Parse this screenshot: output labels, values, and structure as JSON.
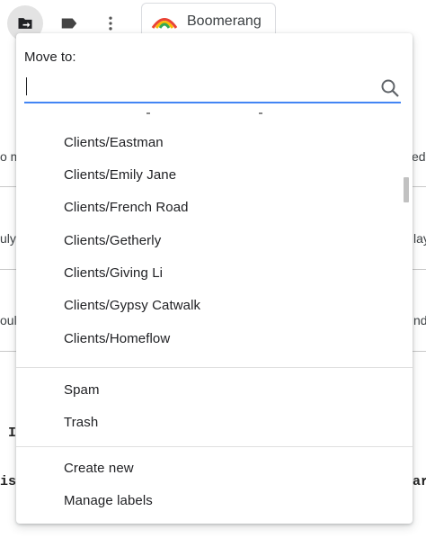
{
  "toolbar": {
    "move_icon": "move-to-folder-icon",
    "label_icon": "label-icon",
    "more_icon": "more-vert-icon",
    "boomerang_label": "Boomerang"
  },
  "background": {
    "fragments": [
      "o m",
      "ed",
      "uly",
      "lay",
      "oul",
      "nd",
      "I",
      "is",
      "ar"
    ]
  },
  "menu": {
    "title": "Move to:",
    "search": {
      "value": "",
      "placeholder": ""
    },
    "folders": [
      "Clients/Eastman",
      "Clients/Emily Jane",
      "Clients/French Road",
      "Clients/Getherly",
      "Clients/Giving Li",
      "Clients/Gypsy Catwalk",
      "Clients/Homeflow"
    ],
    "system": [
      "Spam",
      "Trash"
    ],
    "actions": [
      "Create new",
      "Manage labels"
    ]
  },
  "colors": {
    "accent": "#4285f4",
    "text": "#202124",
    "divider": "#e0e0e0"
  }
}
